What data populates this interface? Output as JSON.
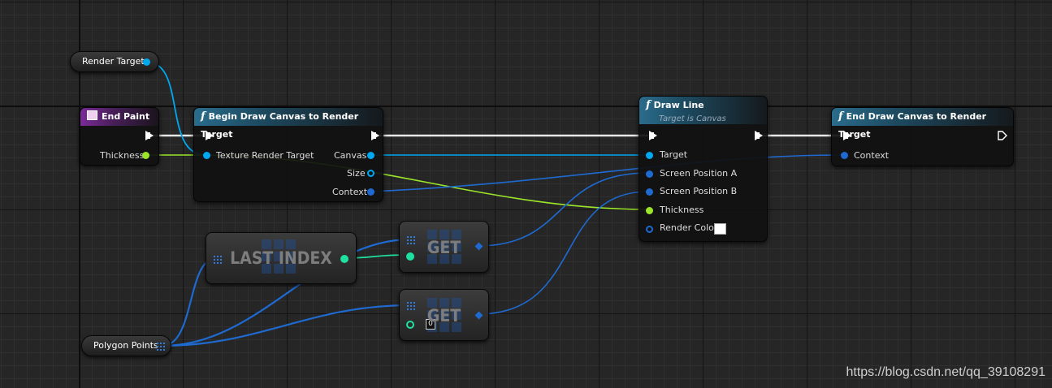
{
  "nodes": {
    "render_target_var": {
      "label": "Render Target"
    },
    "polygon_points_var": {
      "label": "Polygon Points"
    },
    "end_paint": {
      "title": "End Paint",
      "pin_thickness": "Thickness"
    },
    "begin_draw": {
      "title": "Begin Draw Canvas to Render Target",
      "pin_texture": "Texture Render Target",
      "pin_canvas": "Canvas",
      "pin_size": "Size",
      "pin_context": "Context"
    },
    "draw_line": {
      "title": "Draw Line",
      "subtitle": "Target is Canvas",
      "pin_target": "Target",
      "pin_pos_a": "Screen Position A",
      "pin_pos_b": "Screen Position B",
      "pin_thickness": "Thickness",
      "pin_color": "Render Color"
    },
    "end_draw": {
      "title": "End Draw Canvas to Render Target",
      "pin_context": "Context"
    },
    "last_index": {
      "title": "LAST INDEX"
    },
    "get_1": {
      "title": "GET"
    },
    "get_2": {
      "title": "GET",
      "index_value": "0"
    }
  },
  "colors": {
    "exec": "#ffffff",
    "object": "#00a8f0",
    "vector": "#1e6ad0",
    "float": "#9ce62a",
    "integer": "#1ee0a0"
  },
  "watermark": "https://blog.csdn.net/qq_39108291"
}
